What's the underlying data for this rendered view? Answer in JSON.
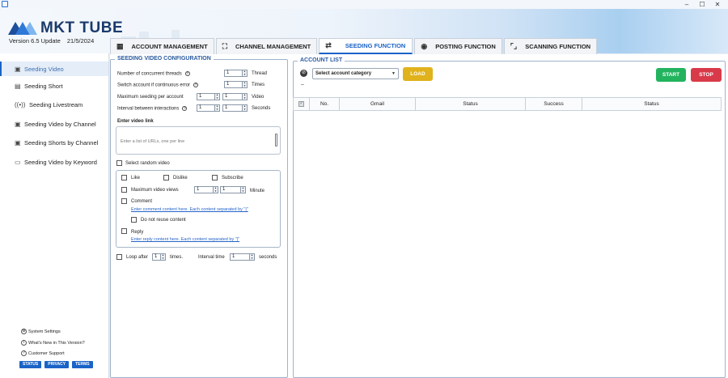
{
  "window": {
    "min": "–",
    "max": "☐",
    "close": "✕"
  },
  "brand": {
    "name": "MKT TUBE",
    "version": "Version  6.5 Update",
    "date": "21/5/2024"
  },
  "tabs": [
    {
      "label": "ACCOUNT MANAGEMENT",
      "icon": "grid-icon"
    },
    {
      "label": "CHANNEL MANAGEMENT",
      "icon": "channel-icon"
    },
    {
      "label": "SEEDING FUNCTION",
      "icon": "transfer-icon"
    },
    {
      "label": "POSTING FUNCTION",
      "icon": "eye-icon"
    },
    {
      "label": "SCANNING FUNCTION",
      "icon": "scan-icon"
    }
  ],
  "sidebar": {
    "items": [
      {
        "label": "Seeding Video",
        "icon": "play-box-icon"
      },
      {
        "label": "Seeding Short",
        "icon": "short-icon"
      },
      {
        "label": "Seeding Livestream",
        "icon": "live-icon"
      },
      {
        "label": "Seeding Video by Channel",
        "icon": "play-box-icon"
      },
      {
        "label": "Seeding Shorts by Channel",
        "icon": "play-box-icon"
      },
      {
        "label": "Seeding Video by Keyword",
        "icon": "keyword-icon"
      }
    ],
    "footer": [
      "System Settings",
      "What's New in This Version?",
      "Customer Support"
    ],
    "badges": [
      "STATUS",
      "PRIVACY",
      "TERMS"
    ]
  },
  "config": {
    "title": "SEEDING VIDEO CONFIGURATION",
    "threads_label": "Number of concurrent threads",
    "threads_value": "1",
    "threads_unit": "Thread",
    "switch_label": "Switch account if continuous error",
    "switch_value": "1",
    "switch_unit": "Times",
    "max_seed_label": "Maximum seeding per account",
    "max_seed_from": "1",
    "max_seed_to": "1",
    "max_seed_unit": "Video",
    "interval_label": "Interval between interactions",
    "interval_from": "1",
    "interval_to": "1",
    "interval_unit": "Seconds",
    "video_link_label": "Enter video link",
    "video_link_placeholder": "Enter a list of URLs, one per line",
    "random_video_label": "Select random video",
    "like_label": "Like",
    "dislike_label": "Dislike",
    "subscribe_label": "Subscribe",
    "max_views_label": "Maximum video views",
    "max_views_from": "1",
    "max_views_to": "1",
    "max_views_unit": "Minute",
    "comment_label": "Comment",
    "comment_link": "Enter comment content here. Each content separated by \"|\"",
    "no_reuse_label": "Do not reuse content",
    "reply_label": "Reply",
    "reply_link": "Enter reply content here. Each content separated by \"|\"",
    "loop_label": "Loop after",
    "loop_value": "1",
    "loop_times": "times.",
    "loop_interval_label": "Interval time",
    "loop_interval_value": "1",
    "loop_interval_unit": "seconds"
  },
  "accounts": {
    "title": "ACCOUNT LIST",
    "category_placeholder": "Select account category",
    "load_label": "LOAD",
    "start_label": "START",
    "stop_label": "STOP",
    "dash": "–",
    "columns": [
      "No.",
      "Gmail",
      "Status",
      "Success",
      "Status"
    ],
    "colors": {
      "load": "#e0b21c",
      "start": "#22b35e",
      "stop": "#d83a4a"
    }
  }
}
